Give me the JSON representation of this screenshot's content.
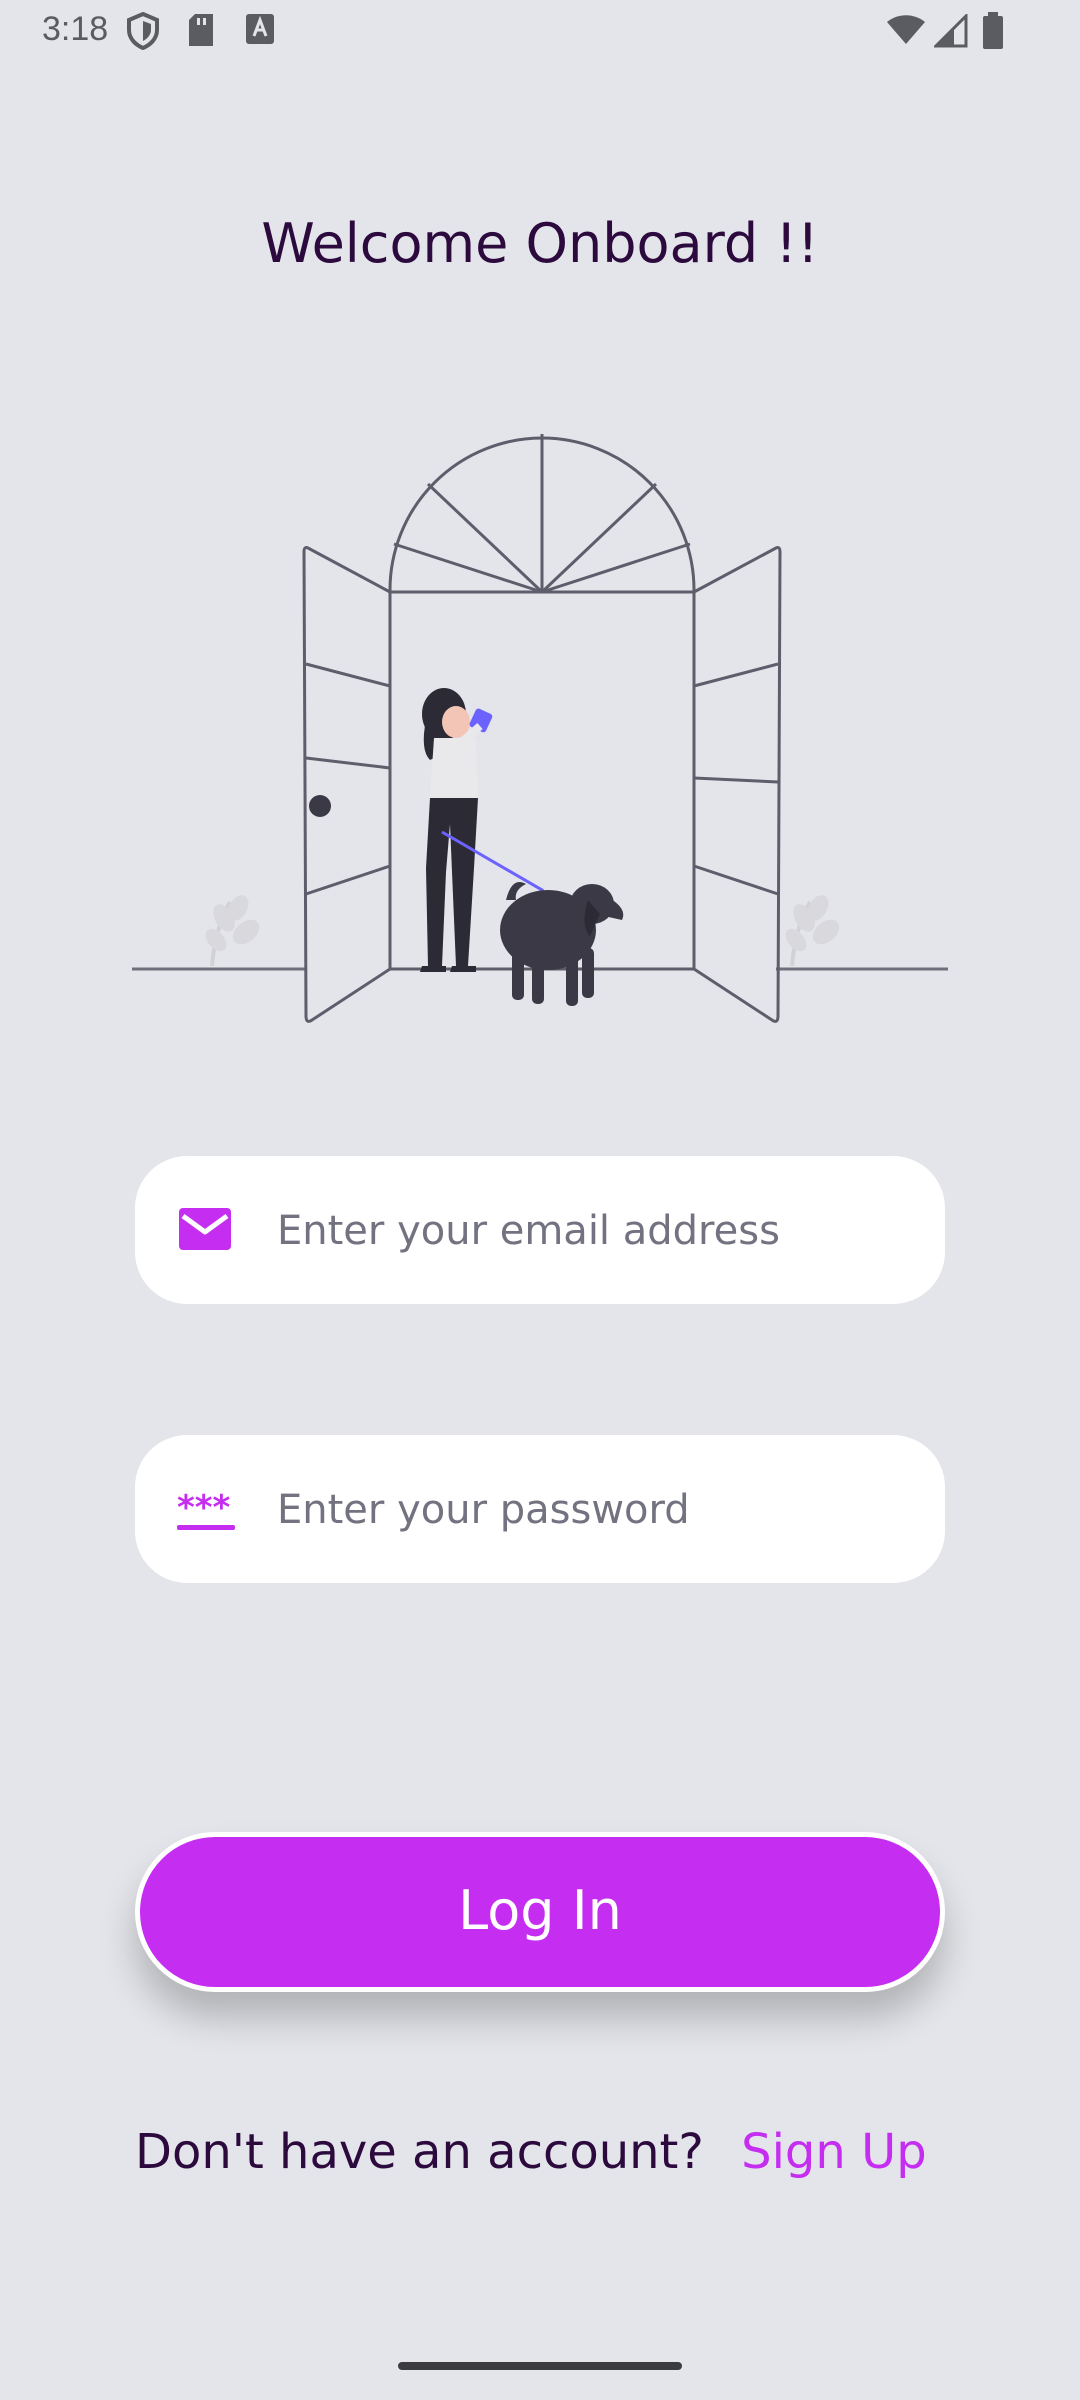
{
  "status_bar": {
    "time": "3:18",
    "left_icons": [
      "shield-icon",
      "sd-card-icon",
      "keyboard-a-icon"
    ],
    "right_icons": [
      "wifi-icon",
      "cell-signal-icon",
      "battery-icon"
    ]
  },
  "header": {
    "title": "Welcome Onboard !!"
  },
  "illustration": {
    "icon": "woman-walking-dog-door-illustration"
  },
  "form": {
    "email": {
      "placeholder": "Enter your email address",
      "value": "",
      "icon": "mail-icon"
    },
    "password": {
      "placeholder": "Enter your password",
      "value": "",
      "icon": "password-asterisks-icon"
    }
  },
  "actions": {
    "login_label": "Log In",
    "signup_prompt": "Don't have an account?",
    "signup_link": "Sign Up"
  },
  "colors": {
    "background": "#E4E5EA",
    "accent": "#C52EF1",
    "title_text": "#2C0A3E",
    "field_background": "#FFFFFF",
    "placeholder_text": "#727280"
  }
}
